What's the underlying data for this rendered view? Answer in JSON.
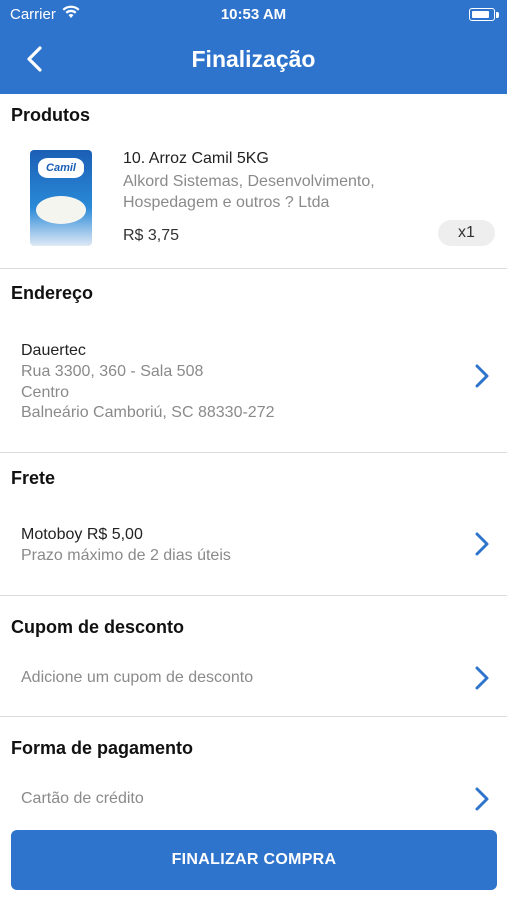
{
  "status_bar": {
    "carrier": "Carrier",
    "time": "10:53 AM"
  },
  "header": {
    "title": "Finalização"
  },
  "products": {
    "title": "Produtos",
    "item": {
      "name": "10. Arroz Camil 5KG",
      "seller": "Alkord Sistemas, Desenvolvimento, Hospedagem e outros ? Ltda",
      "price": "R$ 3,75",
      "quantity": "x1",
      "image_brand": "Camil"
    }
  },
  "address": {
    "title": "Endereço",
    "name": "Dauertec",
    "line1": "Rua 3300, 360  - Sala 508",
    "line2": "Centro",
    "line3": "Balneário Camboriú, SC 88330-272"
  },
  "shipping": {
    "title": "Frete",
    "method": "Motoboy R$ 5,00",
    "deadline": "Prazo máximo de 2 dias úteis"
  },
  "coupon": {
    "title": "Cupom de desconto",
    "placeholder": "Adicione um cupom de desconto"
  },
  "payment": {
    "title": "Forma de pagamento",
    "method": "Cartão de crédito"
  },
  "checkout_button": {
    "label": "FINALIZAR COMPRA"
  },
  "colors": {
    "accent": "#2f74cc",
    "chevron": "#2f74cc"
  }
}
